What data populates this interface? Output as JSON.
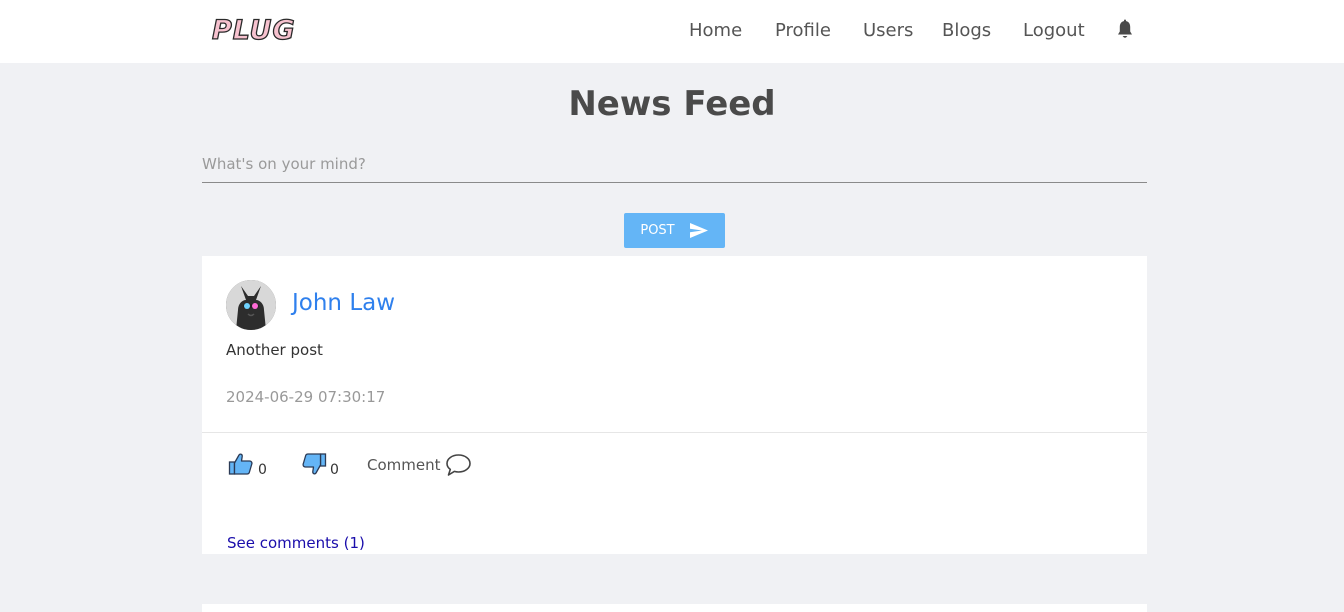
{
  "brand": {
    "logo_text": "PLUG"
  },
  "nav": {
    "items": [
      {
        "label": "Home"
      },
      {
        "label": "Profile"
      },
      {
        "label": "Users"
      },
      {
        "label": "Blogs"
      },
      {
        "label": "Logout"
      }
    ],
    "bell_icon": "bell-icon"
  },
  "page": {
    "title": "News Feed"
  },
  "composer": {
    "placeholder": "What's on your mind?",
    "button_label": "POST",
    "button_icon": "send-icon"
  },
  "posts": [
    {
      "author": "John Law",
      "avatar_icon": "avatar-image",
      "text": "Another post",
      "timestamp": "2024-06-29 07:30:17",
      "likes": "0",
      "dislikes": "0",
      "comment_label": "Comment",
      "see_comments": "See comments (1)"
    }
  ],
  "colors": {
    "accent_button": "#64b5f6",
    "author_link": "#2f80ed",
    "comments_link": "#1a0dab",
    "page_bg": "#f0f1f4",
    "thumb_fill": "#64b5f6"
  }
}
